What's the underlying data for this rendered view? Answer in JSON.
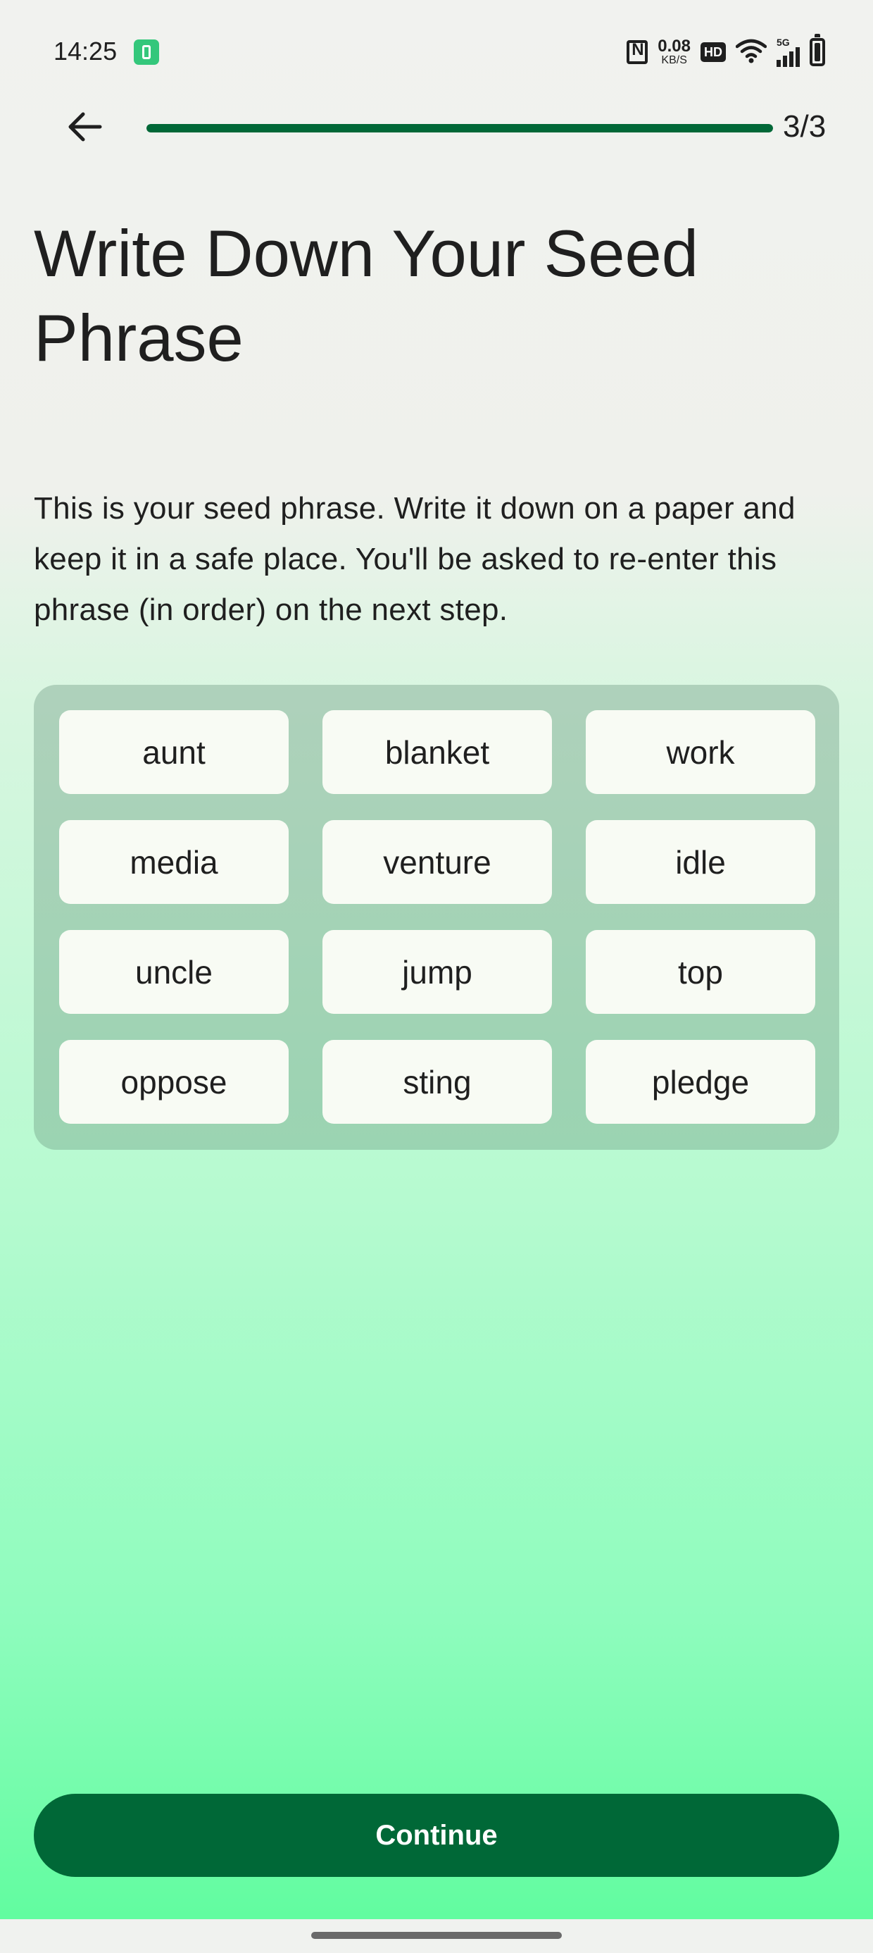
{
  "status_bar": {
    "time": "14:25",
    "net_speed_value": "0.08",
    "net_speed_unit": "KB/S",
    "hd_label": "HD",
    "network_label": "5G"
  },
  "header": {
    "step_counter": "3/3",
    "progress_fraction": 1.0
  },
  "main": {
    "title": "Write Down Your Seed Phrase",
    "description": "This is your seed phrase. Write it down on a paper and keep it in a safe place. You'll be asked to re-enter this phrase (in order) on the next step.",
    "seed_words": [
      "aunt",
      "blanket",
      "work",
      "media",
      "venture",
      "idle",
      "uncle",
      "jump",
      "top",
      "oppose",
      "sting",
      "pledge"
    ]
  },
  "footer": {
    "continue_label": "Continue"
  },
  "colors": {
    "primary": "#006837",
    "chip_bg": "#f8fbf4",
    "gradient_bottom": "#62fca0"
  }
}
